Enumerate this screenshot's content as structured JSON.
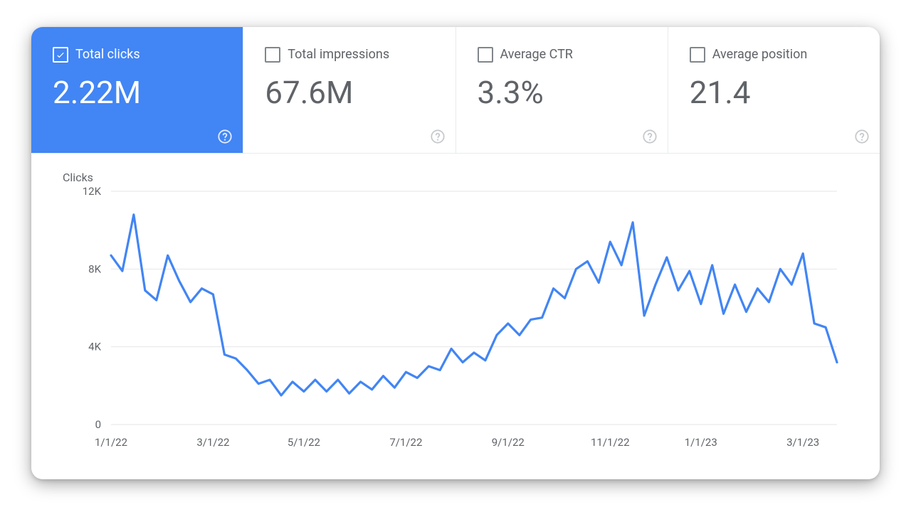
{
  "metrics": [
    {
      "label": "Total clicks",
      "value": "2.22M",
      "checked": true
    },
    {
      "label": "Total impressions",
      "value": "67.6M",
      "checked": false
    },
    {
      "label": "Average CTR",
      "value": "3.3%",
      "checked": false
    },
    {
      "label": "Average position",
      "value": "21.4",
      "checked": false
    }
  ],
  "chart_data": {
    "type": "line",
    "title": "Clicks",
    "xlabel": "",
    "ylabel": "Clicks",
    "ylim": [
      0,
      12000
    ],
    "yticks": [
      0,
      4000,
      8000,
      12000
    ],
    "ytick_labels": [
      "0",
      "4K",
      "8K",
      "12K"
    ],
    "xtick_labels": [
      "1/1/22",
      "3/1/22",
      "5/1/22",
      "7/1/22",
      "9/1/22",
      "11/1/22",
      "1/1/23",
      "3/1/23"
    ],
    "x": [
      "2022-01-01",
      "2022-01-08",
      "2022-01-15",
      "2022-01-22",
      "2022-01-29",
      "2022-02-05",
      "2022-02-12",
      "2022-02-19",
      "2022-02-26",
      "2022-03-05",
      "2022-03-12",
      "2022-03-19",
      "2022-03-26",
      "2022-04-02",
      "2022-04-09",
      "2022-04-16",
      "2022-04-23",
      "2022-04-30",
      "2022-05-07",
      "2022-05-14",
      "2022-05-21",
      "2022-05-28",
      "2022-06-04",
      "2022-06-11",
      "2022-06-18",
      "2022-06-25",
      "2022-07-02",
      "2022-07-09",
      "2022-07-16",
      "2022-07-23",
      "2022-07-30",
      "2022-08-06",
      "2022-08-13",
      "2022-08-20",
      "2022-08-27",
      "2022-09-03",
      "2022-09-10",
      "2022-09-17",
      "2022-09-24",
      "2022-10-01",
      "2022-10-08",
      "2022-10-15",
      "2022-10-22",
      "2022-10-29",
      "2022-11-05",
      "2022-11-12",
      "2022-11-19",
      "2022-11-26",
      "2022-12-03",
      "2022-12-10",
      "2022-12-17",
      "2022-12-24",
      "2022-12-31",
      "2023-01-07",
      "2023-01-14",
      "2023-01-21",
      "2023-01-28",
      "2023-02-04",
      "2023-02-11",
      "2023-02-18",
      "2023-02-25",
      "2023-03-04",
      "2023-03-11",
      "2023-03-18",
      "2023-03-25"
    ],
    "values": [
      8700,
      7900,
      10800,
      6900,
      6400,
      8700,
      7400,
      6300,
      7000,
      6700,
      3600,
      3400,
      2800,
      2100,
      2300,
      1500,
      2200,
      1700,
      2300,
      1700,
      2300,
      1600,
      2200,
      1800,
      2500,
      1900,
      2700,
      2400,
      3000,
      2800,
      3900,
      3200,
      3700,
      3300,
      4600,
      5200,
      4600,
      5400,
      5500,
      7000,
      6500,
      8000,
      8400,
      7300,
      9400,
      8200,
      10400,
      5600,
      7200,
      8600,
      6900,
      7900,
      6200,
      8200,
      5700,
      7200,
      5800,
      7000,
      6300,
      8000,
      7200,
      8800,
      5200,
      5000,
      3200
    ]
  }
}
